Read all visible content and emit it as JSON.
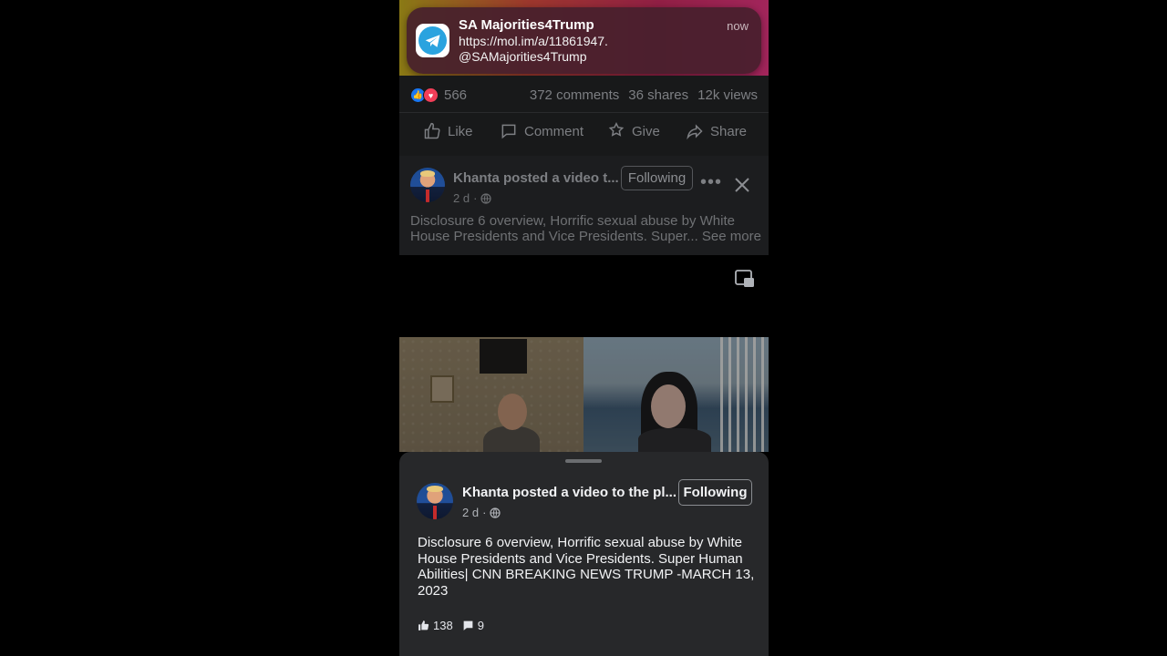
{
  "notification": {
    "title": "SA Majorities4Trump",
    "time": "now",
    "line1": "https://mol.im/a/11861947.",
    "line2": "@SAMajorities4Trump",
    "app_icon": "telegram-icon"
  },
  "post": {
    "reaction_count": "566",
    "comments": "372 comments",
    "shares": "36 shares",
    "views": "12k views",
    "actions": {
      "like": "Like",
      "comment": "Comment",
      "give": "Give",
      "share": "Share"
    }
  },
  "feed_post": {
    "author_line": "Khanta posted a video t...",
    "follow_label": "Following",
    "time": "2 d",
    "text": "Disclosure 6 overview, Horrific sexual abuse by White House Presidents and Vice Presidents. Super...",
    "see_more": "See more"
  },
  "sheet": {
    "author_line": "Khanta posted a video to the pl...",
    "follow_label": "Following",
    "time": "2 d",
    "text": "Disclosure 6 overview, Horrific sexual abuse by White House Presidents and Vice Presidents. Super Human Abilities| CNN BREAKING NEWS TRUMP -MARCH  13, 2023",
    "likes": "138",
    "comments": "9"
  },
  "colors": {
    "like_blue": "#1877f2",
    "love_red": "#f33e58",
    "telegram_blue": "#2aa3df"
  }
}
